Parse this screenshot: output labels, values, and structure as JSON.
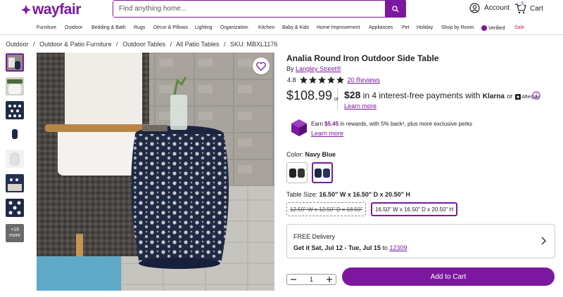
{
  "header": {
    "logo_text": "wayfair",
    "search_placeholder": "Find anything home...",
    "account_label": "Account",
    "cart_label": "Cart",
    "cart_count": "3"
  },
  "nav": {
    "items": [
      "Furniture",
      "Outdoor",
      "Bedding & Bath",
      "Rugs",
      "Décor & Pillows",
      "Lighting",
      "Organization",
      "Kitchen",
      "Baby & Kids",
      "Home Improvement",
      "Appliances",
      "Pet",
      "Holiday",
      "Shop by Room",
      "Verified",
      "Sale"
    ]
  },
  "breadcrumbs": [
    "Outdoor",
    "/",
    "Outdoor & Patio Furniture",
    "/",
    "Outdoor Tables",
    "/",
    "All Patio Tables",
    "/",
    "SKU: MBXL1176"
  ],
  "gallery": {
    "more_label": "+19 more",
    "more_count": "+19",
    "more_word": "more"
  },
  "product": {
    "title": "Analia Round Iron Outdoor Side Table",
    "by": "By",
    "brand": "Langley Street®",
    "rating": "4.8",
    "reviews": "20 Reviews",
    "price": "$108.99",
    "or": "or",
    "installment_amount": "$28",
    "installment_text": "in 4 interest-free payments with",
    "klarna": "Klarna",
    "or2": "or",
    "afterpay": "Afterpay",
    "learn_more": "Learn more",
    "rewards_prefix": "Earn",
    "rewards_amount": "$5.45",
    "rewards_suffix": "in rewards, with 5% back¹, plus more exclusive perks",
    "rewards_learn": "Learn more",
    "color_label": "Color:",
    "color_value": "Navy Blue",
    "size_label": "Table Size:",
    "size_value": "16.50\" W x 16.50\" D x 20.50\" H",
    "size_options": [
      "12.50\" W x 12.50\" D x 18.50\"",
      "16.50\" W x 16.50\" D x 20.50\" H"
    ],
    "delivery_title": "FREE Delivery",
    "delivery_date": "Get it Sat, Jul 12 - Tue, Jul 15",
    "delivery_to": "to",
    "zip": "12309",
    "quantity": "1",
    "add_to_cart": "Add to Cart"
  },
  "colors": {
    "brand": "#7b189f",
    "sale": "#c7254e"
  }
}
